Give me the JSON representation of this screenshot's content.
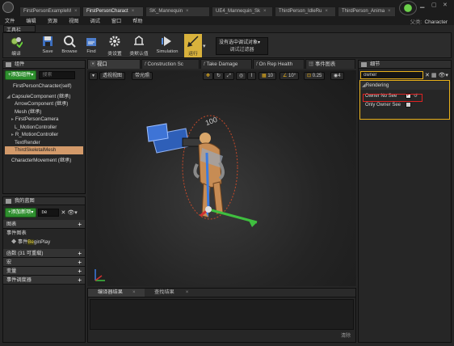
{
  "doc_tabs": [
    {
      "label": "FirstPersonExampleM",
      "active": false
    },
    {
      "label": "FirstPersonCharact",
      "active": true
    },
    {
      "label": "SK_Mannequin",
      "active": false
    },
    {
      "label": "UE4_Mannequin_Sk",
      "active": false
    },
    {
      "label": "ThirdPerson_IdleRu",
      "active": false
    },
    {
      "label": "ThirdPerson_Anima",
      "active": false
    }
  ],
  "menu": [
    "文件",
    "编辑",
    "资源",
    "视图",
    "调试",
    "窗口",
    "帮助"
  ],
  "char_label": {
    "prefix": "父类:",
    "value": "Character"
  },
  "toolbar": {
    "header": "工具栏",
    "buttons": [
      {
        "label": "编译",
        "icon": "compile-icon"
      },
      {
        "label": "Save",
        "icon": "save-icon"
      },
      {
        "label": "Browse",
        "icon": "browse-icon"
      },
      {
        "label": "Find",
        "icon": "find-icon"
      },
      {
        "label": "类设置",
        "icon": "class-settings-icon"
      },
      {
        "label": "类默认值",
        "icon": "class-defaults-icon"
      },
      {
        "label": "Simulation",
        "icon": "simulation-icon"
      },
      {
        "label": "运行",
        "icon": "play-icon"
      }
    ],
    "debug_select": {
      "line1": "没有选中调试对象▾",
      "line2": "调试过滤器"
    }
  },
  "components": {
    "title": "组件",
    "add_button": "+添加组件▾",
    "search_placeholder": "搜索",
    "self_item": "FirstPersonCharacter(self)",
    "items": [
      {
        "label": "CapsuleComponent (继承)",
        "indent": 0,
        "selected": false
      },
      {
        "label": "ArrowComponent (继承)",
        "indent": 1,
        "selected": false
      },
      {
        "label": "Mesh (继承)",
        "indent": 1,
        "selected": false
      },
      {
        "label": "FirstPersonCamera",
        "indent": 1,
        "selected": false
      },
      {
        "label": "L_MotionController",
        "indent": 1,
        "selected": false
      },
      {
        "label": "R_MotionController",
        "indent": 1,
        "selected": false
      },
      {
        "label": "TextRender",
        "indent": 1,
        "selected": false
      },
      {
        "label": "ThirdSkeletalMesh",
        "indent": 1,
        "selected": true
      },
      {
        "label": "CharacterMovement (继承)",
        "indent": 0,
        "selected": false
      }
    ]
  },
  "my_blueprint": {
    "title": "我的蓝图",
    "add_button": "+添加新项▾",
    "search_value": "be",
    "sections": [
      {
        "label": "图表",
        "collapsible": true
      },
      {
        "label": "事件图表",
        "collapsible": true
      },
      {
        "label": "函数 (31 可重载)",
        "collapsible": false
      },
      {
        "label": "宏",
        "collapsible": false
      },
      {
        "label": "变量",
        "collapsible": false
      },
      {
        "label": "事件调度器",
        "collapsible": false
      }
    ],
    "event_item": {
      "prefix": "事件",
      "highlight": "Be",
      "suffix": "ginPlay"
    }
  },
  "editor_tabs": [
    {
      "label": "视口",
      "active": true
    },
    {
      "label": "Construction Sc",
      "active": false
    },
    {
      "label": "Take Damage",
      "active": false
    },
    {
      "label": "On Rep Health",
      "active": false
    },
    {
      "label": "事件图表",
      "active": false
    }
  ],
  "viewport": {
    "perspective": "透视视图",
    "lit": "带光照",
    "grid_snap": "10",
    "rot_snap": "10°",
    "scale_snap": "0.25",
    "cam_speed": "4",
    "floating_text": "100"
  },
  "bottom_tabs": [
    {
      "label": "编译器结果",
      "active": true
    },
    {
      "label": "查找结果",
      "active": false
    }
  ],
  "clear_label": "清除",
  "details": {
    "title": "细节",
    "search_value": "owner",
    "section": "Rendering",
    "rows": [
      {
        "label": "Owner No See",
        "checked": true
      },
      {
        "label": "Only Owner See",
        "checked": false
      }
    ]
  },
  "colors": {
    "accent_orange": "#e8b01a",
    "selection": "#d39a6a",
    "green": "#2e8f2e",
    "red_box": "#dd2222"
  }
}
